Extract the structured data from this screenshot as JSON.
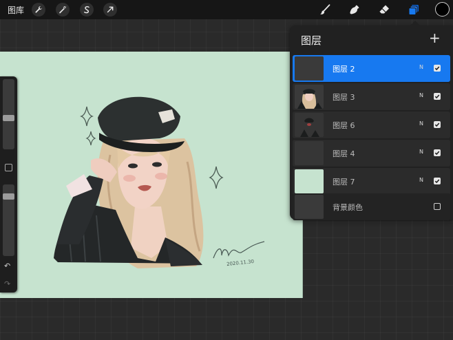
{
  "toolbar": {
    "gallery_label": "图库",
    "left_icons": [
      "wrench-icon",
      "magic-wand-icon",
      "selection-s-icon",
      "transform-arrow-icon"
    ],
    "right_icons": [
      "brush-icon",
      "smudge-icon",
      "eraser-icon",
      "layers-icon"
    ],
    "current_color": "#000000",
    "accent": "#1779f0"
  },
  "signature": {
    "date": "2020.11.30"
  },
  "layers_panel": {
    "title": "图层",
    "add_label": "+",
    "layers": [
      {
        "name": "图层 2",
        "blend": "N",
        "visible": true,
        "selected": true
      },
      {
        "name": "图层 3",
        "blend": "N",
        "visible": true,
        "selected": false
      },
      {
        "name": "图层 6",
        "blend": "N",
        "visible": true,
        "selected": false
      },
      {
        "name": "图层 4",
        "blend": "N",
        "visible": true,
        "selected": false
      },
      {
        "name": "图层 7",
        "blend": "N",
        "visible": true,
        "selected": false
      }
    ],
    "background": {
      "name": "背景颜色",
      "visible": false
    }
  },
  "sidebar": {
    "brush_size": 0.45,
    "opacity": 0.12
  }
}
